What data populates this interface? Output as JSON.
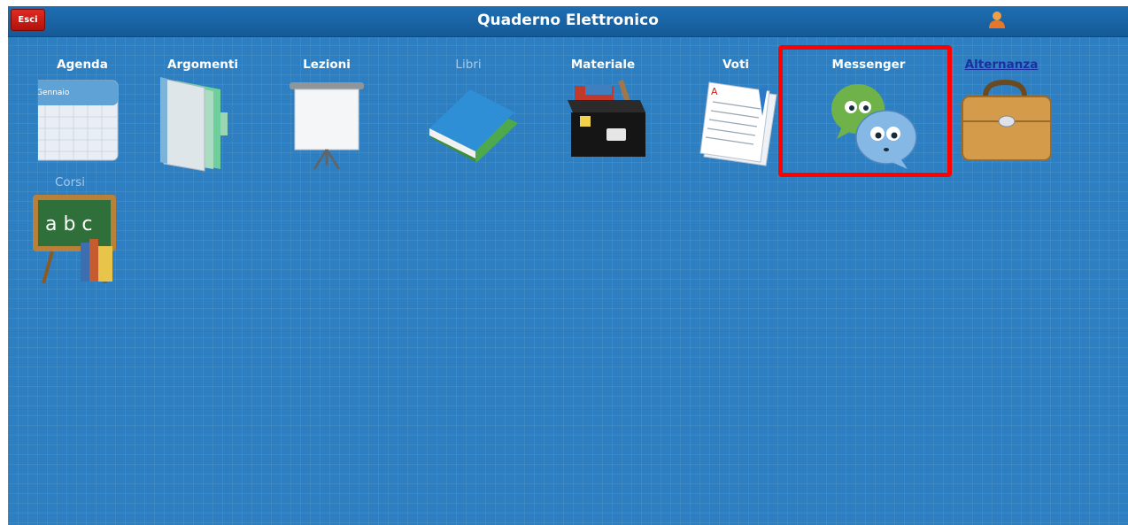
{
  "header": {
    "exit_label": "Esci",
    "title": "Quaderno Elettronico",
    "user_icon": "user-icon"
  },
  "tiles": [
    {
      "label": "Agenda",
      "icon": "calendar-icon",
      "sublabel": "Gennaio"
    },
    {
      "label": "Argomenti",
      "icon": "folders-icon"
    },
    {
      "label": "Lezioni",
      "icon": "projector-screen-icon"
    },
    {
      "label": "Libri",
      "icon": "books-icon",
      "state": "disabled"
    },
    {
      "label": "Materiale",
      "icon": "materials-box-icon"
    },
    {
      "label": "Voti",
      "icon": "grades-paper-icon"
    },
    {
      "label": "Messenger",
      "icon": "chat-bubbles-icon",
      "state": "highlighted"
    },
    {
      "label": "Alternanza",
      "icon": "briefcase-icon",
      "state": "link"
    },
    {
      "label": "Corsi",
      "icon": "chalkboard-icon",
      "board_text": "a b c"
    }
  ],
  "colors": {
    "background": "#2d7fc1",
    "header": "#1a66a8",
    "exit_button": "#c8180f",
    "highlight_box": "#ff0000"
  }
}
